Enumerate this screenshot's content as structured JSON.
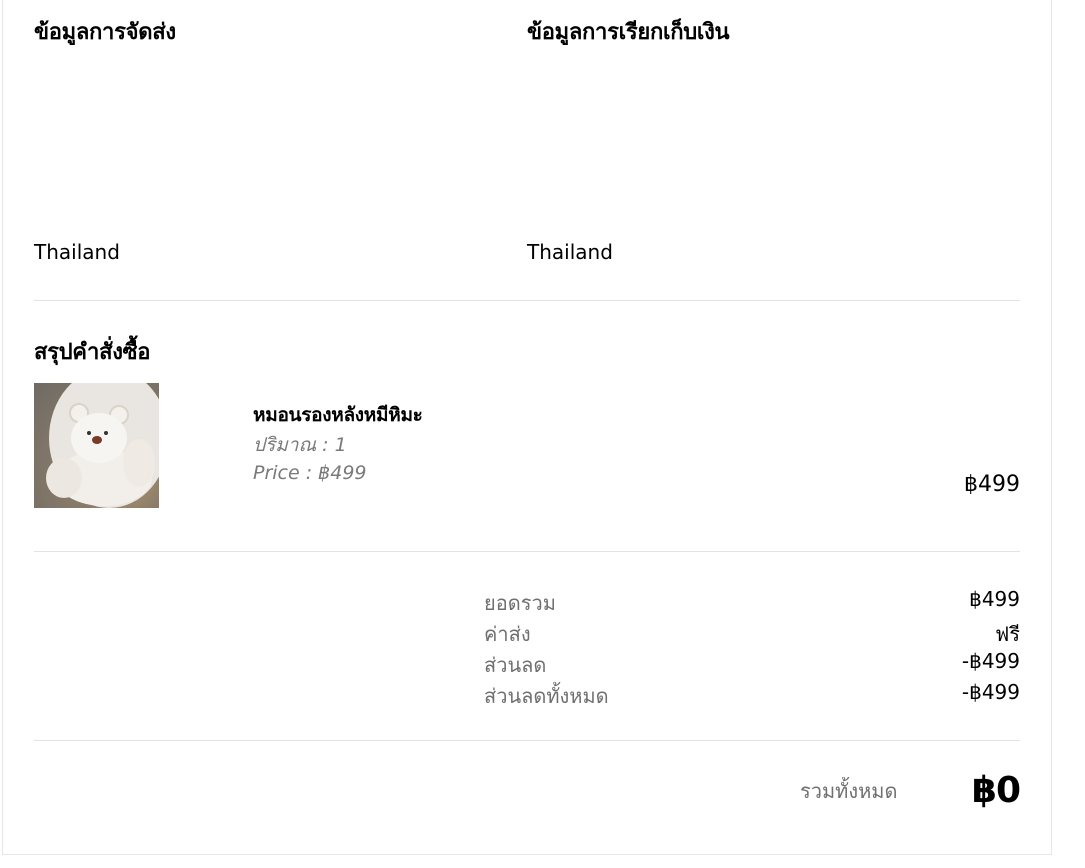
{
  "shipping": {
    "title": "ข้อมูลการจัดส่ง",
    "country": "Thailand"
  },
  "billing": {
    "title": "ข้อมูลการเรียกเก็บเงิน",
    "country": "Thailand"
  },
  "summary": {
    "title": "สรุปคำสั่งซื้อ",
    "item": {
      "name": "หมอนรองหลังหมีหิมะ",
      "quantity": "ปริมาณ : 1",
      "price": "Price : ฿499",
      "line_total": "฿499",
      "image": "white-bear-cushion-photo"
    },
    "rows": [
      {
        "label": "ยอดรวม",
        "value": "฿499"
      },
      {
        "label": "ค่าส่ง",
        "value": "ฟรี"
      },
      {
        "label": "ส่วนลด",
        "value": "-฿499"
      },
      {
        "label": "ส่วนลดทั้งหมด",
        "value": "-฿499"
      }
    ],
    "total_label": "รวมทั้งหมด",
    "total_value": "฿0"
  }
}
